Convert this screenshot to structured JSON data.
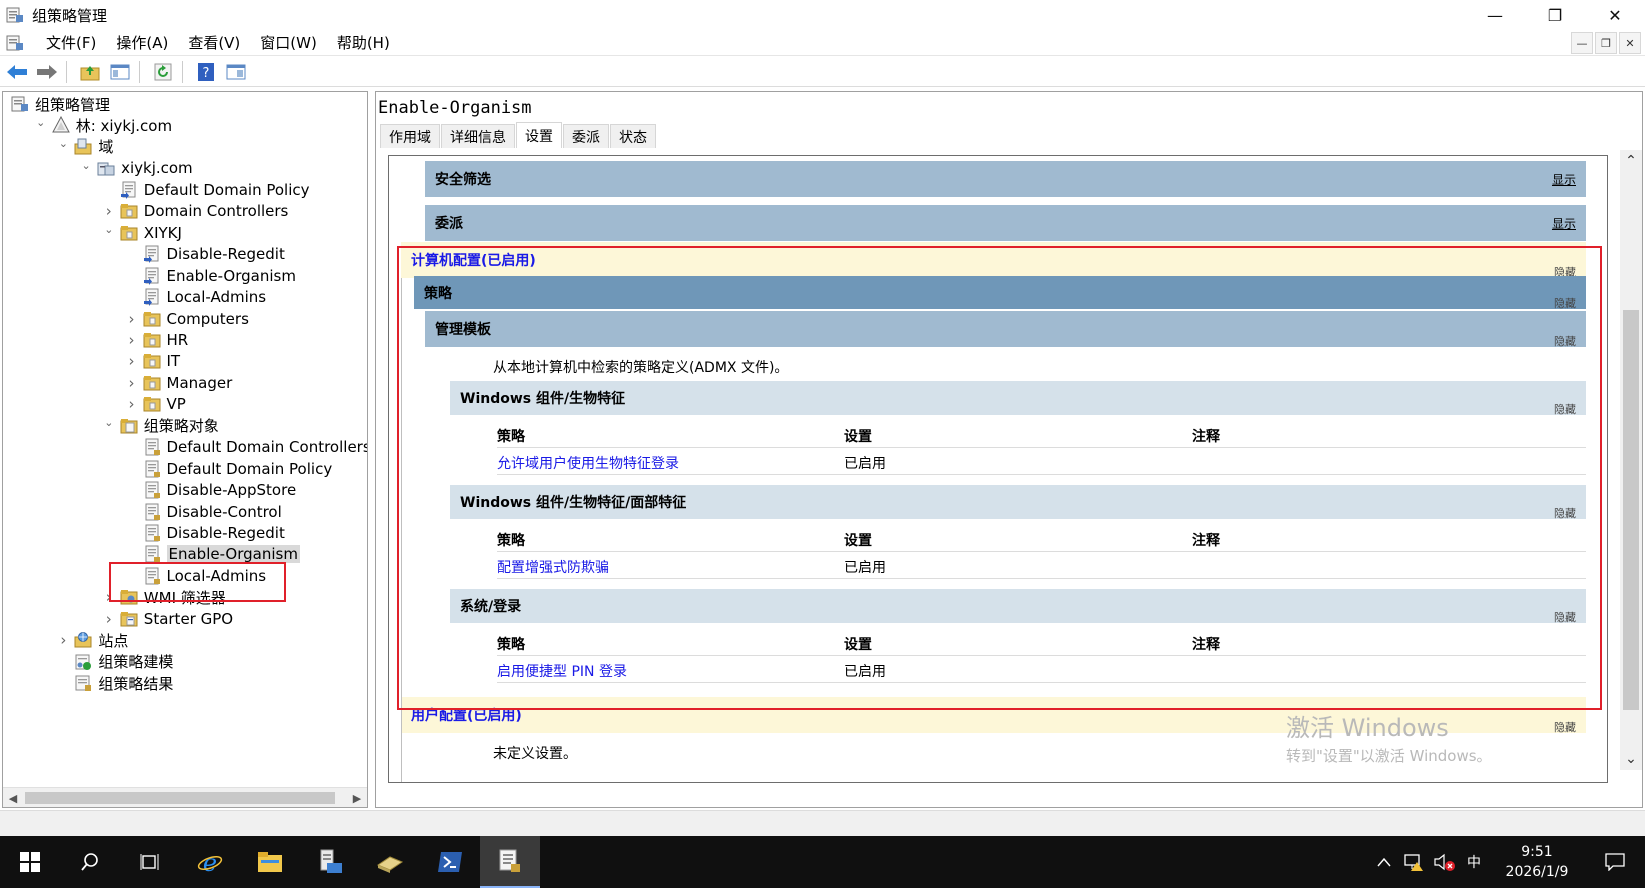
{
  "window": {
    "title": "组策略管理"
  },
  "menu": [
    "文件(F)",
    "操作(A)",
    "查看(V)",
    "窗口(W)",
    "帮助(H)"
  ],
  "tree": [
    {
      "label": "组策略管理",
      "indent": 0,
      "expander": "",
      "icon": "gpmc-icon"
    },
    {
      "label": "林: xiykj.com",
      "indent": 1,
      "expander": "v",
      "icon": "forest-icon"
    },
    {
      "label": "域",
      "indent": 2,
      "expander": "v",
      "icon": "domains-icon"
    },
    {
      "label": "xiykj.com",
      "indent": 3,
      "expander": "v",
      "icon": "domain-icon"
    },
    {
      "label": "Default Domain Policy",
      "indent": 4,
      "expander": "",
      "icon": "gpo-link-icon"
    },
    {
      "label": "Domain Controllers",
      "indent": 4,
      "expander": ">",
      "icon": "ou-icon"
    },
    {
      "label": "XIYKJ",
      "indent": 4,
      "expander": "v",
      "icon": "ou-icon"
    },
    {
      "label": "Disable-Regedit",
      "indent": 5,
      "expander": "",
      "icon": "gpo-link-icon"
    },
    {
      "label": "Enable-Organism",
      "indent": 5,
      "expander": "",
      "icon": "gpo-link-icon"
    },
    {
      "label": "Local-Admins",
      "indent": 5,
      "expander": "",
      "icon": "gpo-link-icon"
    },
    {
      "label": "Computers",
      "indent": 5,
      "expander": ">",
      "icon": "ou-icon"
    },
    {
      "label": "HR",
      "indent": 5,
      "expander": ">",
      "icon": "ou-icon"
    },
    {
      "label": "IT",
      "indent": 5,
      "expander": ">",
      "icon": "ou-icon"
    },
    {
      "label": "Manager",
      "indent": 5,
      "expander": ">",
      "icon": "ou-icon"
    },
    {
      "label": "VP",
      "indent": 5,
      "expander": ">",
      "icon": "ou-icon"
    },
    {
      "label": "组策略对象",
      "indent": 4,
      "expander": "v",
      "icon": "gpo-folder-icon"
    },
    {
      "label": "Default Domain Controllers Poli",
      "indent": 5,
      "expander": "",
      "icon": "gpo-icon"
    },
    {
      "label": "Default Domain Policy",
      "indent": 5,
      "expander": "",
      "icon": "gpo-icon"
    },
    {
      "label": "Disable-AppStore",
      "indent": 5,
      "expander": "",
      "icon": "gpo-icon"
    },
    {
      "label": "Disable-Control",
      "indent": 5,
      "expander": "",
      "icon": "gpo-icon"
    },
    {
      "label": "Disable-Regedit",
      "indent": 5,
      "expander": "",
      "icon": "gpo-icon"
    },
    {
      "label": "Enable-Organism",
      "indent": 5,
      "expander": "",
      "icon": "gpo-icon",
      "selected": true
    },
    {
      "label": "Local-Admins",
      "indent": 5,
      "expander": "",
      "icon": "gpo-icon"
    },
    {
      "label": "WMI 筛选器",
      "indent": 4,
      "expander": ">",
      "icon": "wmi-folder-icon"
    },
    {
      "label": "Starter GPO",
      "indent": 4,
      "expander": ">",
      "icon": "starter-gpo-icon"
    },
    {
      "label": "站点",
      "indent": 2,
      "expander": ">",
      "icon": "sites-icon"
    },
    {
      "label": "组策略建模",
      "indent": 2,
      "expander": "",
      "icon": "modeling-icon"
    },
    {
      "label": "组策略结果",
      "indent": 2,
      "expander": "",
      "icon": "results-icon"
    }
  ],
  "right": {
    "gpo_title": "Enable-Organism",
    "tabs": [
      {
        "label": "作用域",
        "active": false
      },
      {
        "label": "详细信息",
        "active": false
      },
      {
        "label": "设置",
        "active": true
      },
      {
        "label": "委派",
        "active": false
      },
      {
        "label": "状态",
        "active": false
      }
    ]
  },
  "report": {
    "show_label": "显示",
    "hide_label": "隐藏",
    "security_filter": "安全筛选",
    "delegation": "委派",
    "computer_config": "计算机配置(已启用)",
    "policies": "策略",
    "admin_templates": "管理模板",
    "admx_note": "从本地计算机中检索的策略定义(ADMX 文件)。",
    "col_policy": "策略",
    "col_setting": "设置",
    "col_comment": "注释",
    "sections": [
      {
        "title": "Windows 组件/生物特征",
        "policy": "允许域用户使用生物特征登录",
        "setting": "已启用"
      },
      {
        "title": "Windows 组件/生物特征/面部特征",
        "policy": "配置增强式防欺骗",
        "setting": "已启用"
      },
      {
        "title": "系统/登录",
        "policy": "启用便捷型 PIN 登录",
        "setting": "已启用"
      }
    ],
    "user_config": "用户配置(已启用)",
    "user_note": "未定义设置。"
  },
  "watermark": {
    "title": "激活 Windows",
    "subtitle": "转到\"设置\"以激活 Windows。"
  },
  "clock": {
    "time": "9:51",
    "date": "2026/1/9"
  },
  "tray": {
    "ime": "中"
  },
  "colors": {
    "band_dark": "#6f97b8",
    "band_mid": "#a0bad0",
    "band_light": "#d5e1ea",
    "config_band": "#fdf7d8",
    "highlight_red": "#e0202a",
    "link_blue": "#1a1ae6"
  }
}
